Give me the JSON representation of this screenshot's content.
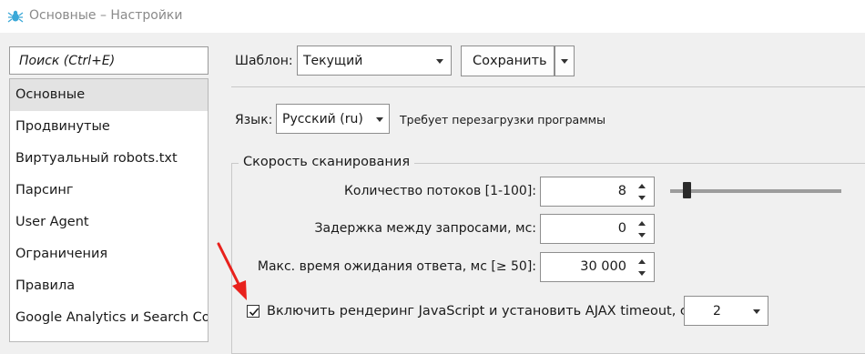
{
  "window": {
    "title": "Основные – Настройки",
    "icon": "spider-logo-icon"
  },
  "sidebar": {
    "search_placeholder": "Поиск (Ctrl+E)",
    "items": [
      {
        "label": "Основные",
        "active": true
      },
      {
        "label": "Продвинутые"
      },
      {
        "label": "Виртуальный robots.txt"
      },
      {
        "label": "Парсинг"
      },
      {
        "label": "User Agent"
      },
      {
        "label": "Ограничения"
      },
      {
        "label": "Правила"
      },
      {
        "label": "Google Analytics и Search Console"
      }
    ]
  },
  "template": {
    "label": "Шаблон:",
    "value": "Текущий",
    "save_label": "Сохранить"
  },
  "language": {
    "label": "Язык:",
    "value": "Русский (ru)",
    "note": "Требует перезагрузки программы"
  },
  "crawl_speed": {
    "title": "Скорость сканирования",
    "threads": {
      "label": "Количество потоков [1-100]:",
      "value": "8",
      "slider_fraction": 0.08
    },
    "delay": {
      "label": "Задержка между запросами, мс:",
      "value": "0"
    },
    "timeout": {
      "label": "Макс. время ожидания ответа, мс [≥ 50]:",
      "value": "30 000"
    }
  },
  "js_rendering": {
    "label": "Включить рендеринг JavaScript и установить AJAX timeout, с:",
    "checked": true,
    "value": "2"
  },
  "colors": {
    "arrow": "#e8211c",
    "active_item_bg": "#e3e3e3",
    "window_bg": "#f0f0f0"
  }
}
